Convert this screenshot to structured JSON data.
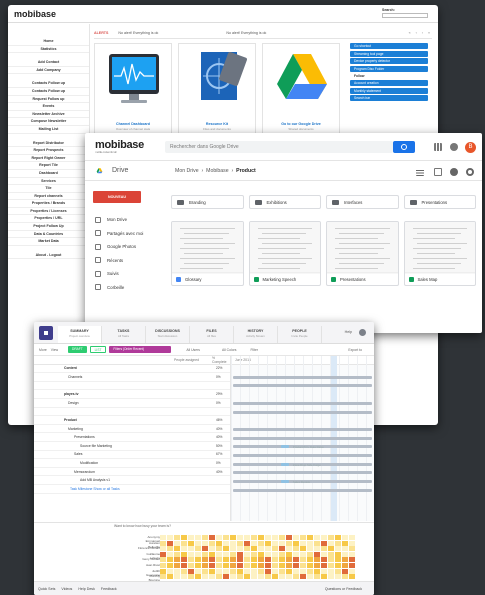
{
  "admin": {
    "logo": "mobibase",
    "search_label": "Search:",
    "sidebar": [
      "Home",
      "Statistics",
      "",
      "Add Contact",
      "Add Company",
      "",
      "Contacts Follow up",
      "Contacts Follow up",
      "Request Follow up",
      "Events",
      "Newsletter Archive",
      "Compose Newsletter",
      "Mailing List",
      "",
      "Report Distributor",
      "Report Prospects",
      "Report Right Owner",
      "Report Tile",
      "Dashboard",
      "Services",
      "Tile",
      "Report channels",
      "Properties / Brands",
      "Properties / Licenses",
      "Properties / URL",
      "Project Follow Up",
      "Data & Countries",
      "Market Data",
      "",
      "About - Logout"
    ],
    "alerts": {
      "title": "ALERTS",
      "msg1": "No alert! Everything is ok",
      "msg2": "No alert! Everything is ok",
      "pager": "« ‹ › »"
    },
    "cards": [
      {
        "caption": "Channel Dashboard",
        "sub": "Overview of channel stats"
      },
      {
        "caption": "Resource Kit",
        "sub": "Files and documents"
      },
      {
        "caption": "Go to our Google Drive",
        "sub": "Shared documents"
      }
    ],
    "buttons": [
      "Go shortcut",
      "Streaming tool page",
      "Device property detector",
      "Program Disc Folder"
    ],
    "buttons_head": "Follow",
    "buttons2": [
      "Account creation",
      "Monthly statement",
      "Search bar"
    ]
  },
  "drive": {
    "logo": "mobibase",
    "logo_sub": "mobile content for all",
    "search_placeholder": "Rechercher dans Google Drive",
    "avatar": "B",
    "title": "Drive",
    "crumbs": {
      "a": "Mon Drive",
      "b": "Mobibase",
      "c": "Product"
    },
    "new_button": "NOUVEAU",
    "nav": [
      "Mon Drive",
      "Partagés avec moi",
      "Google Photos",
      "Récents",
      "Suivis",
      "Corbeille"
    ],
    "quota": "2 Go utilisés sur 30 Go",
    "folders": [
      "Branding",
      "Exhibitions",
      "Interfaces",
      "Presentations"
    ],
    "files": [
      {
        "name": "Glossary",
        "color": "#4285f4"
      },
      {
        "name": "Marketing Speech",
        "color": "#0f9d58"
      },
      {
        "name": "Presentations",
        "color": "#0f9d58"
      },
      {
        "name": "Sales Map",
        "color": "#0f9d58"
      }
    ]
  },
  "project": {
    "tabs": [
      {
        "label": "SUMMARY",
        "sub": "Project overview"
      },
      {
        "label": "TASKS",
        "sub": "All Tasks"
      },
      {
        "label": "DISCUSSIONS",
        "sub": "Start discussion"
      },
      {
        "label": "FILES",
        "sub": "All files"
      },
      {
        "label": "HISTORY",
        "sub": "Activity Stream"
      },
      {
        "label": "PEOPLE",
        "sub": "Invite People"
      }
    ],
    "help": "Help",
    "bar": {
      "more": "More",
      "view": "View",
      "draft": "DRAFT",
      "list": "LIST",
      "filter": "Filters (Order Recent)",
      "all_users": "All Users",
      "all_colors": "All Colors",
      "filter_label": "Filter",
      "export": "Export to"
    },
    "cols": {
      "assignee": "People assigned",
      "complete": "% Complete",
      "month": "June 2016"
    },
    "rows": [
      {
        "name": "Content",
        "pct": "22%",
        "bold": true,
        "indent": 30
      },
      {
        "name": "Channels",
        "pct": "0%",
        "bold": false,
        "indent": 34
      },
      {
        "name": "",
        "pct": "",
        "bold": false,
        "indent": 0
      },
      {
        "name": "playes.tv",
        "pct": "29%",
        "bold": true,
        "indent": 30
      },
      {
        "name": "Design",
        "pct": "0%",
        "bold": false,
        "indent": 34
      },
      {
        "name": "",
        "pct": "",
        "bold": false,
        "indent": 0
      },
      {
        "name": "Product",
        "pct": "46%",
        "bold": true,
        "indent": 30
      },
      {
        "name": "Marketing",
        "pct": "40%",
        "bold": false,
        "indent": 34
      },
      {
        "name": "Presentations",
        "pct": "40%",
        "bold": false,
        "indent": 40
      },
      {
        "name": "Source file Marketing",
        "pct": "50%",
        "bold": false,
        "indent": 46
      },
      {
        "name": "Sales",
        "pct": "67%",
        "bold": false,
        "indent": 40
      },
      {
        "name": "Modification",
        "pct": "0%",
        "bold": false,
        "indent": 46
      },
      {
        "name": "Memorandum",
        "pct": "40%",
        "bold": false,
        "indent": 40
      },
      {
        "name": "Add MB Analysis v1",
        "pct": "",
        "bold": false,
        "indent": 46
      },
      {
        "name": "Task  Milestone  Show or all Tasks",
        "pct": "",
        "bold": false,
        "indent": 36
      }
    ],
    "gantt_labels": [
      "Product Prin. Data Raise",
      "Zone Drop Side Forge",
      "Sales Review"
    ],
    "heat": {
      "question": "Want to know how busy your team is?",
      "people": [
        "Anonymy Emmanuel",
        "Aurelien Belleville",
        "Florence Duvant",
        "Guillaume Lefevre",
        "Geny Guitaut",
        "Jean Rivet",
        "Judith Guenonne",
        "Monthly Bourgne"
      ]
    },
    "footer": [
      "Quick Sets",
      "Videos",
      "Help Desk",
      "Feedback"
    ],
    "footer_right": "Questions or Feedback"
  }
}
